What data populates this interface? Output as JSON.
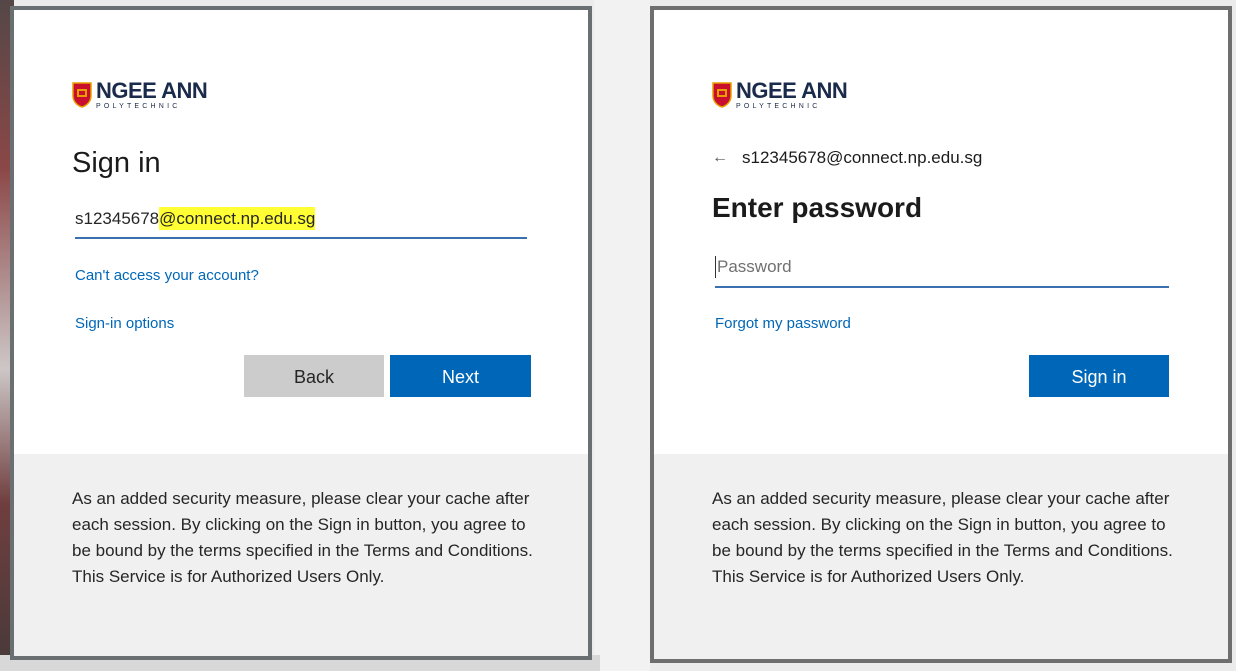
{
  "logo": {
    "name": "NGEE ANN",
    "sub": "POLYTECHNIC"
  },
  "left_panel": {
    "title": "Sign in",
    "email_prefix": "s12345678",
    "email_domain": "@connect.np.edu.sg",
    "cant_access_link": "Can't access your account?",
    "signin_options_link": "Sign-in options",
    "back_button": "Back",
    "next_button": "Next",
    "footer_text": "As an added security measure, please clear your cache after each session. By clicking on the Sign in button, you agree to be bound by the terms specified in the Terms and Conditions. This Service is for Authorized Users Only."
  },
  "right_panel": {
    "back_arrow": "←",
    "identity": "s12345678@connect.np.edu.sg",
    "title": "Enter password",
    "password_placeholder": "Password",
    "forgot_link": "Forgot my password",
    "signin_button": "Sign in",
    "footer_text": "As an added security measure, please clear your cache after each session. By clicking on the Sign in button, you agree to be bound by the terms specified in the Terms and Conditions. This Service is for Authorized Users Only."
  },
  "colors": {
    "accent": "#0067b8",
    "input_underline": "#3a6fb0",
    "highlight": "#ffff33",
    "secondary_button": "#cccccc",
    "footer_bg": "#f0f0f0"
  },
  "icons": {
    "logo_shield": "crest-shield-icon",
    "back": "arrow-left-icon"
  }
}
